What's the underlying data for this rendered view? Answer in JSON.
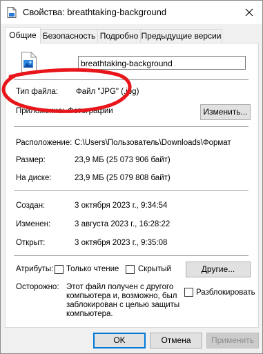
{
  "window": {
    "title": "Свойства: breathtaking-background"
  },
  "tabs": [
    {
      "label": "Общие"
    },
    {
      "label": "Безопасность"
    },
    {
      "label": "Подробно"
    },
    {
      "label": "Предыдущие версии"
    }
  ],
  "general": {
    "file_name": "breathtaking-background",
    "file_type_label": "Тип файла:",
    "file_type_value": "Файл \"JPG\" (.jpg)",
    "opens_with_label": "Приложение:",
    "opens_with_value": "Фотографии",
    "change_button": "Изменить...",
    "location_label": "Расположение:",
    "location_value": "C:\\Users\\Пользователь\\Downloads\\Формат",
    "size_label": "Размер:",
    "size_value": "23,9 МБ (25 073 906 байт)",
    "disk_size_label": "На диске:",
    "disk_size_value": "23,9 МБ (25 079 808 байт)",
    "created_label": "Создан:",
    "created_value": "3 октября 2023 г., 9:34:54",
    "modified_label": "Изменен:",
    "modified_value": "3 августа 2023 г., 16:28:22",
    "accessed_label": "Открыт:",
    "accessed_value": "3 октября 2023 г., 9:35:08",
    "attributes_label": "Атрибуты:",
    "readonly_label": "Только чтение",
    "hidden_label": "Скрытый",
    "other_button": "Другие...",
    "warning_label": "Осторожно:",
    "warning_text_1": "Этот файл получен с другого",
    "warning_text_2": "компьютера и, возможно, был",
    "warning_text_3": "заблокирован с целью защиты",
    "warning_text_4": "компьютера.",
    "unblock_label": "Разблокировать"
  },
  "footer": {
    "ok": "OK",
    "cancel": "Отмена",
    "apply": "Применить"
  },
  "annotation": {
    "color": "#e8161b"
  }
}
